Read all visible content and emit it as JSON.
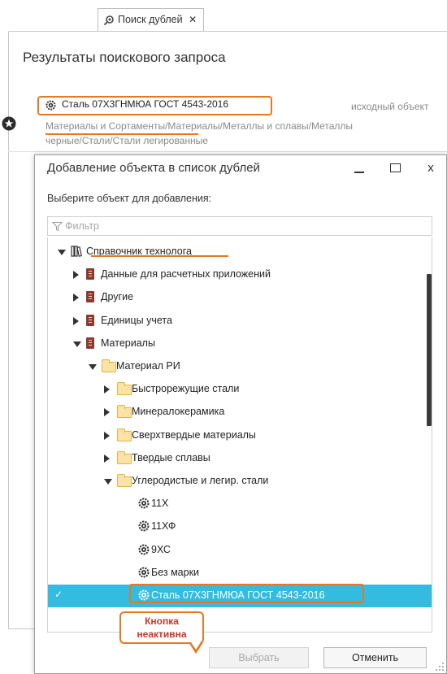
{
  "tab": {
    "label": "Поиск дублей",
    "close": "✕"
  },
  "results": {
    "title": "Результаты поискового запроса",
    "item_name": "Сталь 07Х3ГНМЮА ГОСТ 4543-2016",
    "item_tag": "исходный объект",
    "path_link": "Материалы и Сортаменты",
    "path_rest": "/Материалы/Металлы и сплавы/Металлы",
    "path_line2": "черные/Стали/Стали легированные"
  },
  "dialog": {
    "title": "Добавление объекта в список дублей",
    "close": "x",
    "prompt": "Выберите объект для добавления:",
    "filter_placeholder": "Фильтр",
    "tree": [
      {
        "label": "Справочник технолога",
        "level": 0,
        "state": "expanded",
        "icon": "library-icon"
      },
      {
        "label": "Данные для расчетных приложений",
        "level": 1,
        "state": "collapsed",
        "icon": "book-icon"
      },
      {
        "label": "Другие",
        "level": 1,
        "state": "collapsed",
        "icon": "book-icon"
      },
      {
        "label": "Единицы учета",
        "level": 1,
        "state": "collapsed",
        "icon": "book-icon"
      },
      {
        "label": "Материалы",
        "level": 1,
        "state": "expanded",
        "icon": "book-icon"
      },
      {
        "label": "Материал РИ",
        "level": 2,
        "state": "expanded",
        "icon": "folder-icon"
      },
      {
        "label": "Быстрорежущие стали",
        "level": 3,
        "state": "collapsed",
        "icon": "folder-icon"
      },
      {
        "label": "Минералокерамика",
        "level": 3,
        "state": "collapsed",
        "icon": "folder-icon"
      },
      {
        "label": "Сверхтвердые материалы",
        "level": 3,
        "state": "collapsed",
        "icon": "folder-icon"
      },
      {
        "label": "Твердые  сплавы",
        "level": 3,
        "state": "collapsed",
        "icon": "folder-icon"
      },
      {
        "label": "Углеродистые и легир. стали",
        "level": 3,
        "state": "expanded",
        "icon": "folder-icon"
      },
      {
        "label": "11Х",
        "level": 4,
        "state": "leaf",
        "icon": "gear-icon"
      },
      {
        "label": "11ХФ",
        "level": 4,
        "state": "leaf",
        "icon": "gear-icon"
      },
      {
        "label": "9ХС",
        "level": 4,
        "state": "leaf",
        "icon": "gear-icon"
      },
      {
        "label": "Без марки",
        "level": 4,
        "state": "leaf",
        "icon": "gear-icon"
      },
      {
        "label": "Сталь 07Х3ГНМЮА ГОСТ 4543-2016",
        "level": 4,
        "state": "leaf",
        "icon": "gear-icon",
        "selected": true
      }
    ],
    "callout": {
      "line1": "Кнопка",
      "line2": "неактивна"
    },
    "select_button": "Выбрать",
    "cancel_button": "Отменить"
  },
  "colors": {
    "highlight": "#e87722",
    "selection": "#33bce0",
    "callout_text": "#c0392b"
  }
}
